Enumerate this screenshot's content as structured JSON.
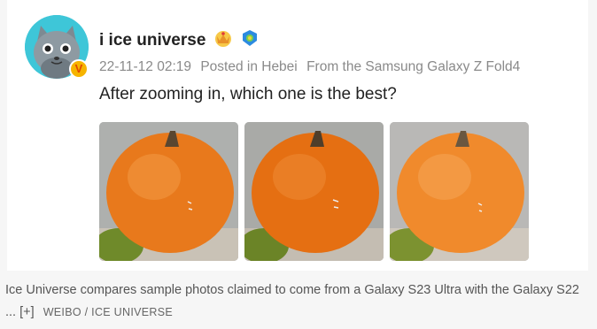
{
  "post": {
    "username": "i ice universe",
    "timestamp": "22-11-12 02:19",
    "location": "Posted in Hebei",
    "device": "From the Samsung Galaxy Z Fold4",
    "text": "After zooming in, which one is the best?",
    "avatar_badge": "V",
    "badges": [
      "crown-badge-icon",
      "blue-verified-icon"
    ],
    "photos": [
      {
        "name": "pumpkin-photo-1",
        "tint": "#e8791c"
      },
      {
        "name": "pumpkin-photo-2",
        "tint": "#e56f12"
      },
      {
        "name": "pumpkin-photo-3",
        "tint": "#f08a2c"
      }
    ]
  },
  "caption": {
    "text": "Ice Universe compares sample photos claimed to come from a Galaxy S23 Ultra with the Galaxy S22 ...",
    "more": "[+]",
    "credit": "WEIBO / ICE UNIVERSE"
  },
  "colors": {
    "accent_avatar": "#3ec6d8",
    "badge_gold": "#f6b400",
    "meta_text": "#8a8a8a"
  }
}
